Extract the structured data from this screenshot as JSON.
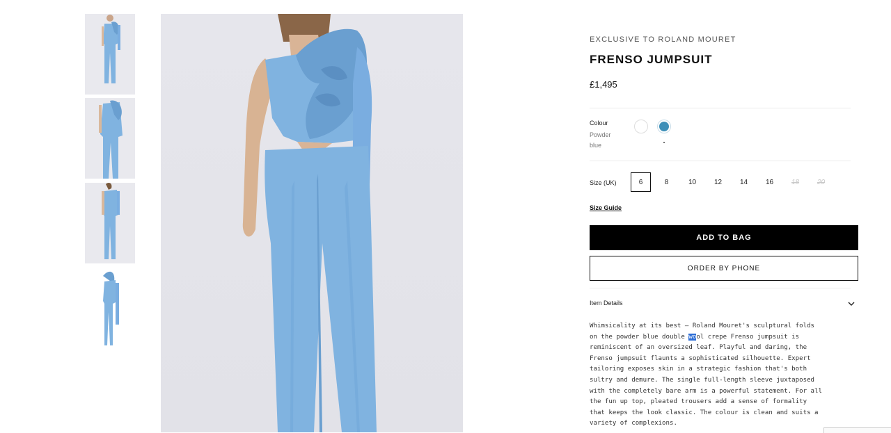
{
  "thumbnails": [
    {
      "label": "front view"
    },
    {
      "label": "front view close"
    },
    {
      "label": "back view"
    },
    {
      "label": "flat lay"
    }
  ],
  "product": {
    "brand": "EXCLUSIVE TO ROLAND MOURET",
    "title": "FRENSO JUMPSUIT",
    "price": "£1,495"
  },
  "colour": {
    "label": "Colour",
    "name": "Powder blue",
    "swatches": [
      {
        "name": "white",
        "color": "#ffffff"
      },
      {
        "name": "powder blue",
        "color": "#3d8fb8",
        "selected": true
      }
    ]
  },
  "size": {
    "label": "Size (UK)",
    "options": [
      {
        "value": "6",
        "selected": true
      },
      {
        "value": "8"
      },
      {
        "value": "10"
      },
      {
        "value": "12"
      },
      {
        "value": "14"
      },
      {
        "value": "16"
      },
      {
        "value": "18",
        "disabled": true
      },
      {
        "value": "20",
        "disabled": true
      }
    ],
    "guide_label": "Size Guide"
  },
  "actions": {
    "add_to_bag": "ADD TO BAG",
    "order_by_phone": "ORDER BY PHONE"
  },
  "details": {
    "label": "Item Details",
    "lines": [
      {
        "text": "Whimsicality at its best – Roland Mouret's sculptural folds"
      },
      {
        "pre": "on the powder blue double ",
        "hl": "wo",
        "post": "ol crepe Frenso jumpsuit is"
      },
      {
        "text": "reminiscent of an oversized leaf. Playful and daring, the"
      },
      {
        "text": "Frenso jumpsuit flaunts a sophisticated silhouette. Expert"
      },
      {
        "text": "tailoring exposes skin in a strategic fashion that's both"
      },
      {
        "text": "sultry and demure. The single full-length sleeve juxtaposed"
      },
      {
        "text": "with the completely bare arm is a powerful statement. For all"
      },
      {
        "text": "the fun up top, pleated trousers add a sense of formality"
      },
      {
        "text": "that keeps the look classic. The colour is clean and suits a"
      },
      {
        "text": "variety of complexions."
      }
    ]
  },
  "colors": {
    "garment": "#80b3e0",
    "garment_shadow": "#6a9fd0",
    "button_primary": "#000000",
    "selection_highlight": "#2f6fd6"
  }
}
